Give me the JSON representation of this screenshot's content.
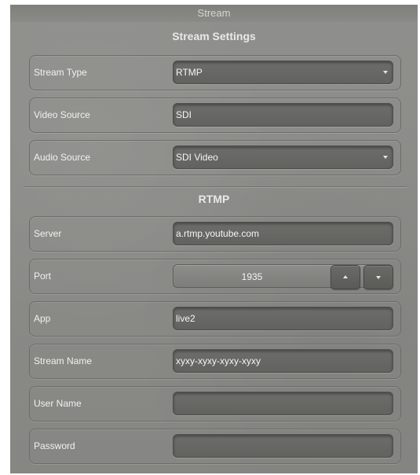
{
  "window": {
    "title": "Stream"
  },
  "stream_settings": {
    "heading": "Stream Settings",
    "stream_type": {
      "label": "Stream Type",
      "value": "RTMP"
    },
    "video_source": {
      "label": "Video Source",
      "value": "SDI"
    },
    "audio_source": {
      "label": "Audio Source",
      "value": "SDI Video"
    }
  },
  "rtmp": {
    "heading": "RTMP",
    "server": {
      "label": "Server",
      "value": "a.rtmp.youtube.com"
    },
    "port": {
      "label": "Port",
      "value": "1935"
    },
    "app": {
      "label": "App",
      "value": "live2"
    },
    "stream_name": {
      "label": "Stream Name",
      "value": "xyxy-xyxy-xyxy-xyxy"
    },
    "user_name": {
      "label": "User Name",
      "value": ""
    },
    "password": {
      "label": "Password",
      "value": ""
    }
  },
  "icons": [
    "caret-down-icon",
    "arrow-up-icon",
    "arrow-down-icon"
  ]
}
